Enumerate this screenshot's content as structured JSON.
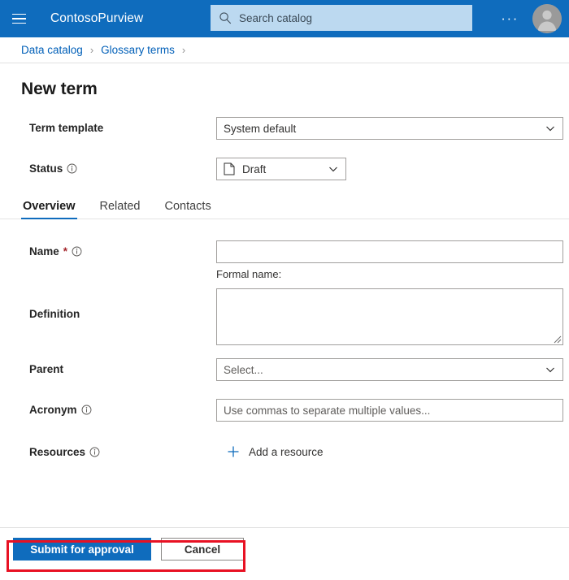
{
  "appbar": {
    "menu_icon": "hamburger-icon",
    "brand": "ContosoPurview",
    "search": {
      "icon": "search-icon",
      "placeholder": "Search catalog",
      "value": ""
    },
    "more_label": "···",
    "avatar_icon": "user-avatar-icon"
  },
  "breadcrumb": {
    "items": [
      {
        "label": "Data catalog"
      },
      {
        "label": "Glossary terms"
      }
    ],
    "separator": "›"
  },
  "page": {
    "title": "New term"
  },
  "form": {
    "term_template": {
      "label": "Term template",
      "value": "System default",
      "chevron_icon": "chevron-down-icon"
    },
    "status": {
      "label": "Status",
      "info_icon": "info-icon",
      "value": "Draft",
      "value_icon": "document-icon",
      "chevron_icon": "chevron-down-icon"
    },
    "name": {
      "label": "Name",
      "required_marker": "*",
      "info_icon": "info-icon",
      "value": "",
      "placeholder": "",
      "helper": "Formal name:"
    },
    "definition": {
      "label": "Definition",
      "value": "",
      "placeholder": "",
      "resize_handle": "resize-grip-icon"
    },
    "parent": {
      "label": "Parent",
      "placeholder": "Select...",
      "chevron_icon": "chevron-down-icon"
    },
    "acronym": {
      "label": "Acronym",
      "info_icon": "info-icon",
      "value": "",
      "placeholder": "Use commas to separate multiple values..."
    },
    "resources": {
      "label": "Resources",
      "info_icon": "info-icon",
      "add_label": "Add a resource",
      "add_icon": "plus-icon"
    }
  },
  "tabs": [
    {
      "label": "Overview",
      "active": true
    },
    {
      "label": "Related",
      "active": false
    },
    {
      "label": "Contacts",
      "active": false
    }
  ],
  "footer": {
    "submit_label": "Submit for approval",
    "cancel_label": "Cancel"
  },
  "colors": {
    "brand_blue": "#0f6cbd",
    "search_bg": "#bcd9f0",
    "link_blue": "#005fb8",
    "required_red": "#a4262c",
    "highlight_red": "#e81123",
    "border_gray": "#a19f9d"
  }
}
